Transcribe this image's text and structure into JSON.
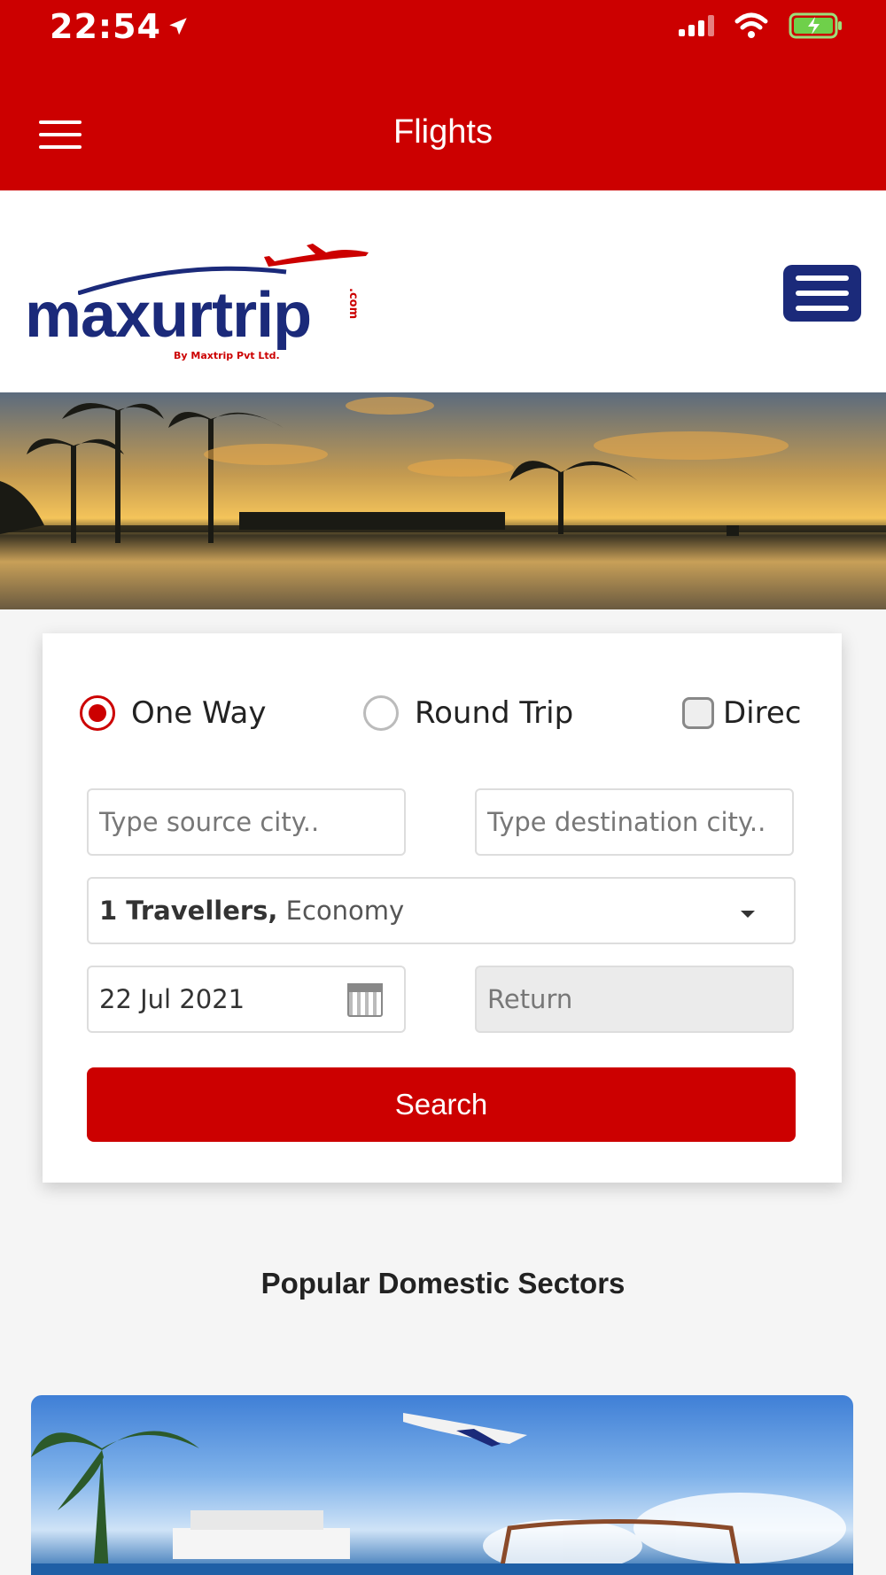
{
  "status_bar": {
    "time": "22:54"
  },
  "app_bar": {
    "title": "Flights"
  },
  "brand": {
    "name": "maxurtrip",
    "tagline": "By Maxtrip Pvt Ltd.",
    "domain": ".com"
  },
  "search": {
    "trip_types": [
      {
        "label": "One Way",
        "selected": true
      },
      {
        "label": "Round Trip",
        "selected": false
      }
    ],
    "direct_label": "Direc",
    "source_placeholder": "Type source city..",
    "destination_placeholder": "Type destination city..",
    "travellers_count": "1 Travellers,",
    "cabin_class": "Economy",
    "depart_date": "22 Jul 2021",
    "return_placeholder": "Return",
    "search_label": "Search"
  },
  "sections": {
    "popular_title": "Popular Domestic Sectors"
  },
  "colors": {
    "primary": "#cc0000",
    "brand_blue": "#1b2a7a"
  }
}
